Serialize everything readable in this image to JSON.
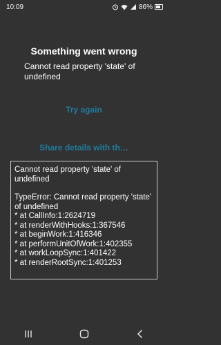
{
  "status_bar": {
    "time": "10:09",
    "battery": "86%"
  },
  "error_screen": {
    "title": "Something went wrong",
    "message": "Cannot read property 'state' of undefined",
    "try_again_label": "Try again",
    "share_label": "Share details with th…"
  },
  "error_details": {
    "message": "Cannot read property 'state' of undefined",
    "error_line": "TypeError: Cannot read property 'state' of undefined",
    "stack": [
      "* at CallInfo:1:2624719",
      "* at renderWithHooks:1:367546",
      "* at beginWork:1:416346",
      "* at performUnitOfWork:1:402355",
      "* at workLoopSync:1:401422",
      "* at renderRootSync:1:401253"
    ]
  },
  "nav_bar": {
    "icons": [
      "recent-apps-icon",
      "home-icon",
      "back-icon"
    ]
  },
  "colors": {
    "background": "#323232",
    "accent": "#1f7c9c",
    "text": "#ffffff"
  }
}
